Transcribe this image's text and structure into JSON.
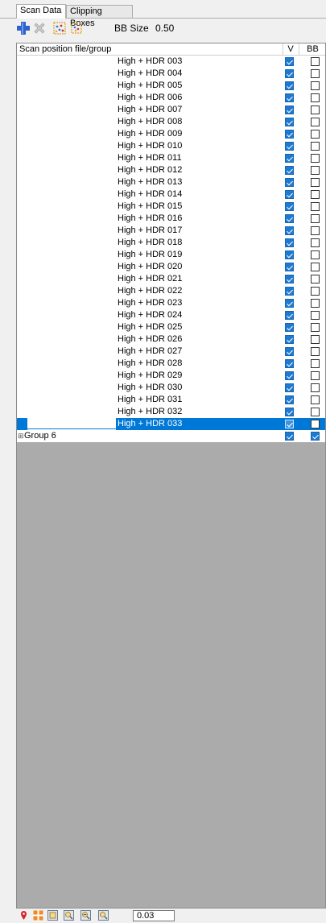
{
  "tabs": {
    "scan_data": "Scan Data",
    "clipping_boxes": "Clipping Boxes"
  },
  "toolbar": {
    "icons": [
      "add-icon",
      "remove-icon",
      "bb-mark-icon",
      "bb-unmark-icon"
    ],
    "bb_size_label": "BB Size",
    "bb_size_value": "0.50"
  },
  "table": {
    "headers": {
      "name": "Scan position file/group",
      "v": "V",
      "bb": "BB"
    },
    "rows": [
      {
        "name": "High + HDR 003",
        "v": true,
        "bb": false
      },
      {
        "name": "High + HDR 004",
        "v": true,
        "bb": false
      },
      {
        "name": "High + HDR 005",
        "v": true,
        "bb": false
      },
      {
        "name": "High + HDR 006",
        "v": true,
        "bb": false
      },
      {
        "name": "High + HDR 007",
        "v": true,
        "bb": false
      },
      {
        "name": "High + HDR 008",
        "v": true,
        "bb": false
      },
      {
        "name": "High + HDR 009",
        "v": true,
        "bb": false
      },
      {
        "name": "High + HDR 010",
        "v": true,
        "bb": false
      },
      {
        "name": "High + HDR 011",
        "v": true,
        "bb": false
      },
      {
        "name": "High + HDR 012",
        "v": true,
        "bb": false
      },
      {
        "name": "High + HDR 013",
        "v": true,
        "bb": false
      },
      {
        "name": "High + HDR 014",
        "v": true,
        "bb": false
      },
      {
        "name": "High + HDR 015",
        "v": true,
        "bb": false
      },
      {
        "name": "High + HDR 016",
        "v": true,
        "bb": false
      },
      {
        "name": "High + HDR 017",
        "v": true,
        "bb": false
      },
      {
        "name": "High + HDR 018",
        "v": true,
        "bb": false
      },
      {
        "name": "High + HDR 019",
        "v": true,
        "bb": false
      },
      {
        "name": "High + HDR 020",
        "v": true,
        "bb": false
      },
      {
        "name": "High + HDR 021",
        "v": true,
        "bb": false
      },
      {
        "name": "High + HDR 022",
        "v": true,
        "bb": false
      },
      {
        "name": "High + HDR 023",
        "v": true,
        "bb": false
      },
      {
        "name": "High + HDR 024",
        "v": true,
        "bb": false
      },
      {
        "name": "High + HDR 025",
        "v": true,
        "bb": false
      },
      {
        "name": "High + HDR 026",
        "v": true,
        "bb": false
      },
      {
        "name": "High + HDR 027",
        "v": true,
        "bb": false
      },
      {
        "name": "High + HDR 028",
        "v": true,
        "bb": false
      },
      {
        "name": "High + HDR 029",
        "v": true,
        "bb": false
      },
      {
        "name": "High + HDR 030",
        "v": true,
        "bb": false
      },
      {
        "name": "High + HDR 031",
        "v": true,
        "bb": false
      },
      {
        "name": "High + HDR 032",
        "v": true,
        "bb": false
      },
      {
        "name": "High + HDR 033",
        "v": true,
        "bb": false,
        "selected": true
      }
    ],
    "group": {
      "name": "Group 6",
      "expander": "⊞",
      "v": true,
      "bb": true
    }
  },
  "bottom_toolbar": {
    "icons": [
      "marker-icon",
      "crosshair-icon",
      "zoom-icon",
      "zoom-in-icon",
      "zoom-out-icon",
      "zoom-fit-icon"
    ],
    "value": "0.03"
  },
  "colors": {
    "selection": "#0078d7",
    "checked": "#1e7ad1",
    "empty_area": "#ababab"
  }
}
